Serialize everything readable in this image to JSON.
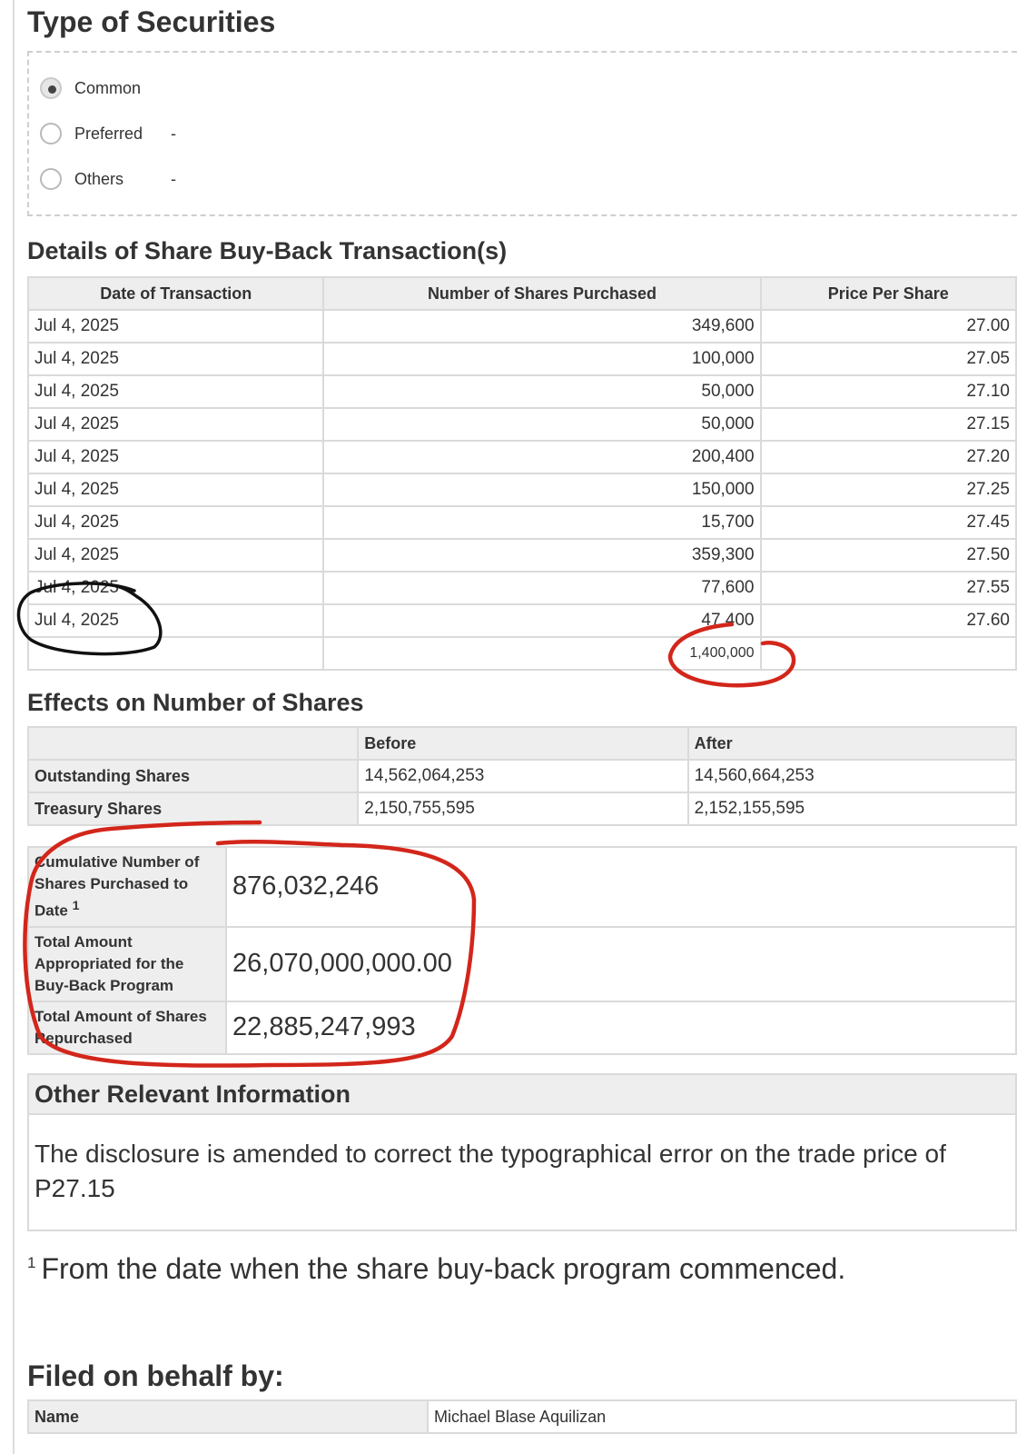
{
  "type_of_securities": {
    "heading": "Type of Securities",
    "options": [
      {
        "label": "Common",
        "value": "",
        "selected": true
      },
      {
        "label": "Preferred",
        "value": "-",
        "selected": false
      },
      {
        "label": "Others",
        "value": "-",
        "selected": false
      }
    ]
  },
  "transactions": {
    "heading": "Details of Share Buy-Back Transaction(s)",
    "columns": [
      "Date of Transaction",
      "Number of Shares Purchased",
      "Price Per Share"
    ],
    "rows": [
      {
        "date": "Jul 4, 2025",
        "shares": "349,600",
        "price": "27.00"
      },
      {
        "date": "Jul 4, 2025",
        "shares": "100,000",
        "price": "27.05"
      },
      {
        "date": "Jul 4, 2025",
        "shares": "50,000",
        "price": "27.10"
      },
      {
        "date": "Jul 4, 2025",
        "shares": "50,000",
        "price": "27.15"
      },
      {
        "date": "Jul 4, 2025",
        "shares": "200,400",
        "price": "27.20"
      },
      {
        "date": "Jul 4, 2025",
        "shares": "150,000",
        "price": "27.25"
      },
      {
        "date": "Jul 4, 2025",
        "shares": "15,700",
        "price": "27.45"
      },
      {
        "date": "Jul 4, 2025",
        "shares": "359,300",
        "price": "27.50"
      },
      {
        "date": "Jul 4, 2025",
        "shares": "77,600",
        "price": "27.55"
      },
      {
        "date": "Jul 4, 2025",
        "shares": "47,400",
        "price": "27.60"
      }
    ],
    "total_shares": "1,400,000"
  },
  "effects": {
    "heading": "Effects on Number of Shares",
    "columns": [
      "",
      "Before",
      "After"
    ],
    "rows": [
      {
        "label": "Outstanding Shares",
        "before": "14,562,064,253",
        "after": "14,560,664,253"
      },
      {
        "label": "Treasury Shares",
        "before": "2,150,755,595",
        "after": "2,152,155,595"
      }
    ]
  },
  "summary": {
    "cumulative_label": "Cumulative Number of Shares Purchased to Date",
    "cumulative_footnote_mark": "1",
    "cumulative_value": "876,032,246",
    "appropriated_label": "Total Amount Appropriated for the Buy-Back Program",
    "appropriated_value": "26,070,000,000.00",
    "repurchased_label": "Total Amount of Shares Repurchased",
    "repurchased_value": "22,885,247,993"
  },
  "other_info": {
    "heading": "Other Relevant Information",
    "text": "The disclosure is amended to correct the typographical error on the trade price of P27.15"
  },
  "footnote": {
    "mark": "1",
    "text": "From the date when the share buy-back program commenced."
  },
  "filed": {
    "heading": "Filed on behalf by:",
    "name_label": "Name",
    "name_value": "Michael Blase Aquilizan"
  },
  "annotation_colors": {
    "black_circle": "#111111",
    "red_circles": "#d3261b"
  }
}
